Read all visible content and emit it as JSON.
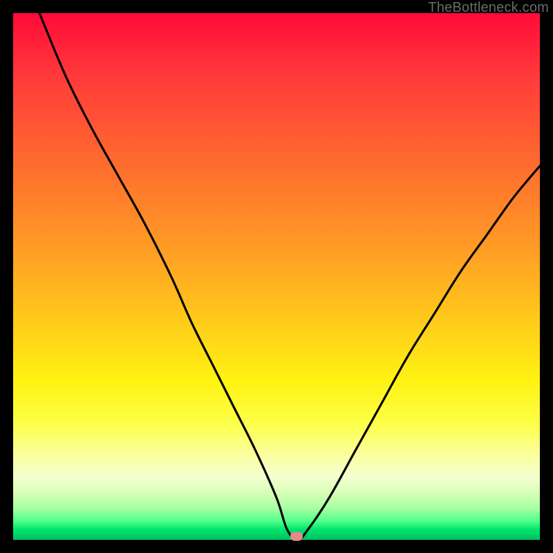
{
  "watermark": "TheBottleneck.com",
  "marker": {
    "x_pct": 53.8,
    "y_pct": 99.3
  },
  "chart_data": {
    "type": "line",
    "title": "",
    "xlabel": "",
    "ylabel": "",
    "xlim": [
      0,
      100
    ],
    "ylim": [
      0,
      100
    ],
    "grid": false,
    "series": [
      {
        "name": "bottleneck-curve",
        "x": [
          5,
          10,
          15,
          20,
          25,
          30,
          34,
          38,
          42,
          46,
          50,
          52,
          54,
          56,
          60,
          65,
          70,
          75,
          80,
          85,
          90,
          95,
          100
        ],
        "y": [
          100,
          88,
          78,
          69,
          60,
          50,
          41,
          33,
          25,
          17,
          8,
          2,
          0,
          2,
          8,
          17,
          26,
          35,
          43,
          51,
          58,
          65,
          71
        ]
      }
    ],
    "annotations": [
      {
        "type": "marker",
        "x": 53.8,
        "y": 0.7,
        "label": "optimal-point"
      }
    ],
    "background_gradient": {
      "direction": "vertical",
      "stops": [
        {
          "pos": 0.0,
          "color": "#ff0a3a"
        },
        {
          "pos": 0.5,
          "color": "#ffb020"
        },
        {
          "pos": 0.75,
          "color": "#fff312"
        },
        {
          "pos": 0.92,
          "color": "#c8ffb0"
        },
        {
          "pos": 1.0,
          "color": "#00c060"
        }
      ]
    }
  }
}
